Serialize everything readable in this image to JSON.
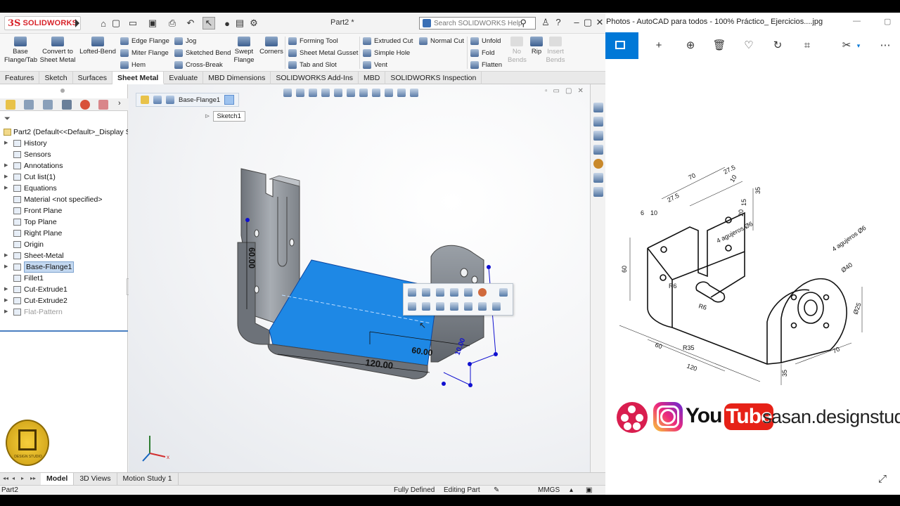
{
  "solidworks": {
    "brand": "SOLIDWORKS",
    "brand_ds": "3S",
    "document_title": "Part2 *",
    "search_placeholder": "Search SOLIDWORKS Help",
    "ribbon": {
      "base_flange": "Base\nFlange/Tab",
      "convert": "Convert to\nSheet Metal",
      "lofted_bend": "Lofted-Bend",
      "edge_flange": "Edge Flange",
      "miter_flange": "Miter Flange",
      "hem": "Hem",
      "jog": "Jog",
      "sketched_bend": "Sketched Bend",
      "cross_break": "Cross-Break",
      "swept_flange": "Swept\nFlange",
      "corners": "Corners",
      "forming_tool": "Forming Tool",
      "gusset": "Sheet Metal Gusset",
      "tab_slot": "Tab and Slot",
      "extruded_cut": "Extruded Cut",
      "simple_hole": "Simple Hole",
      "vent": "Vent",
      "normal_cut": "Normal Cut",
      "unfold": "Unfold",
      "fold": "Fold",
      "flatten": "Flatten",
      "no_bends": "No\nBends",
      "rip": "Rip",
      "insert_bends": "Insert\nBends"
    },
    "tabs": [
      "Features",
      "Sketch",
      "Surfaces",
      "Sheet Metal",
      "Evaluate",
      "MBD Dimensions",
      "SOLIDWORKS Add-Ins",
      "MBD",
      "SOLIDWORKS Inspection"
    ],
    "active_tab": "Sheet Metal",
    "tree": {
      "root": "Part2  (Default<<Default>_Display S",
      "items": [
        {
          "label": "History",
          "expand": true
        },
        {
          "label": "Sensors",
          "expand": false
        },
        {
          "label": "Annotations",
          "expand": true
        },
        {
          "label": "Cut list(1)",
          "expand": true
        },
        {
          "label": "Equations",
          "expand": true
        },
        {
          "label": "Material <not specified>",
          "expand": false
        },
        {
          "label": "Front Plane",
          "expand": false
        },
        {
          "label": "Top Plane",
          "expand": false
        },
        {
          "label": "Right Plane",
          "expand": false
        },
        {
          "label": "Origin",
          "expand": false
        },
        {
          "label": "Sheet-Metal",
          "expand": true
        },
        {
          "label": "Base-Flange1",
          "expand": true,
          "selected": true
        },
        {
          "label": "Fillet1",
          "expand": false
        },
        {
          "label": "Cut-Extrude1",
          "expand": true
        },
        {
          "label": "Cut-Extrude2",
          "expand": true
        },
        {
          "label": "Flat-Pattern",
          "expand": true,
          "grey": true
        }
      ]
    },
    "breadcrumb": {
      "feature": "Base-Flange1",
      "sketch": "Sketch1"
    },
    "model_dims": {
      "height": "60.00",
      "length": "120.00",
      "width": "60.00",
      "thickness": "10.00"
    },
    "badge_text": "DESIGN STUDIO",
    "bottom_tabs": [
      "Model",
      "3D Views",
      "Motion Study 1"
    ],
    "active_bottom_tab": "Model",
    "status": {
      "doc": "Part2",
      "defined": "Fully Defined",
      "mode": "Editing Part",
      "units": "MMGS"
    },
    "colors": {
      "brand_red": "#d8232a",
      "selected_face": "#1e88e5",
      "dim_blue": "#1010d0"
    }
  },
  "photos": {
    "title": "Photos - AutoCAD para todos - 100% Práctico_ Ejercicios....jpg",
    "toolbar_icons": [
      "gallery-icon",
      "add-icon",
      "zoom-in-icon",
      "delete-icon",
      "favorite-icon",
      "rotate-icon",
      "crop-icon",
      "edit-icon",
      "more-icon"
    ],
    "drawing_dims": [
      "70",
      "27.5",
      "10",
      "27.5",
      "6",
      "10",
      "15",
      "35",
      "20",
      "4 agujeros Ø6",
      "4 agujeros Ø6",
      "Ø40",
      "Ø25",
      "60",
      "R6",
      "R6",
      "60",
      "R35",
      "120",
      "35",
      "70"
    ],
    "social": {
      "youtube_you": "You",
      "youtube_tube": "Tube",
      "site": "sasan.designstudio"
    }
  }
}
